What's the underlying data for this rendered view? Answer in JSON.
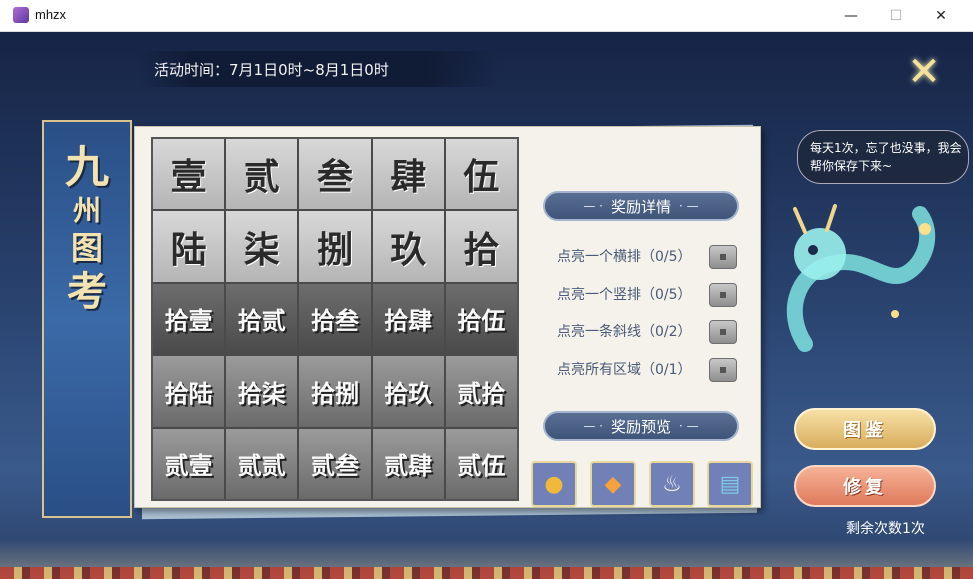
{
  "window": {
    "title": "mhzx",
    "minimize": "—",
    "maximize": "☐",
    "close": "✕"
  },
  "event": {
    "time": "活动时间：7月1日0时~8月1日0时",
    "close_glyph": "✕"
  },
  "banner": {
    "title_chars": [
      "九",
      "州",
      "图",
      "考"
    ]
  },
  "grid": {
    "cells": [
      "壹",
      "贰",
      "叁",
      "肆",
      "伍",
      "陆",
      "柒",
      "捌",
      "玖",
      "拾",
      "拾壹",
      "拾贰",
      "拾叁",
      "拾肆",
      "拾伍",
      "拾陆",
      "拾柒",
      "拾捌",
      "拾玖",
      "贰拾",
      "贰壹",
      "贰贰",
      "贰叁",
      "贰肆",
      "贰伍"
    ]
  },
  "rewards": {
    "detail_title": "奖励详情",
    "preview_title": "奖励预览",
    "title_deco": "—  ·",
    "title_deco_r": "·  —",
    "tasks": [
      {
        "label": "点亮一个横排（0/5）"
      },
      {
        "label": "点亮一个竖排（0/5）"
      },
      {
        "label": "点亮一条斜线（0/2）"
      },
      {
        "label": "点亮所有区域（0/1）"
      }
    ],
    "preview_items": [
      {
        "icon": "gold-ingot-icon",
        "glyph": "●",
        "color": "#f0b93a"
      },
      {
        "icon": "fish-icon",
        "glyph": "◆",
        "color": "#f4a23a"
      },
      {
        "icon": "teapot-icon",
        "glyph": "♨",
        "color": "#ffffff"
      },
      {
        "icon": "ticket-icon",
        "glyph": "▤",
        "color": "#7ec8e8"
      }
    ]
  },
  "mascot": {
    "speech": "每天1次，忘了也没事，我会帮你保存下来~"
  },
  "actions": {
    "atlas_label": "图鉴",
    "repair_label": "修复",
    "remaining": "剩余次数1次"
  }
}
